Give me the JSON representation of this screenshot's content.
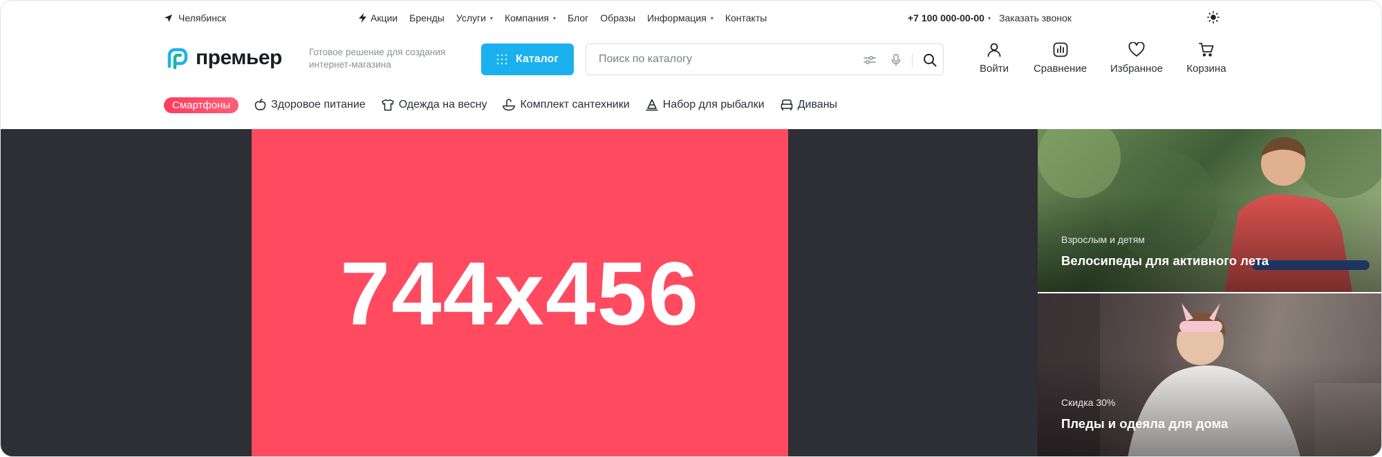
{
  "topbar": {
    "city": "Челябинск",
    "nav": [
      {
        "label": "Акции",
        "icon": "lightning-icon"
      },
      {
        "label": "Бренды"
      },
      {
        "label": "Услуги",
        "dropdown": true
      },
      {
        "label": "Компания",
        "dropdown": true
      },
      {
        "label": "Блог"
      },
      {
        "label": "Образы"
      },
      {
        "label": "Информация",
        "dropdown": true
      },
      {
        "label": "Контакты"
      }
    ],
    "phone": "+7 100 000-00-00",
    "callback": "Заказать звонок"
  },
  "header": {
    "logo_text": "премьер",
    "tagline": "Готовое решение для создания интернет-магазина",
    "catalog_label": "Каталог",
    "search_placeholder": "Поиск по каталогу",
    "actions": [
      {
        "label": "Войти",
        "icon": "user-icon"
      },
      {
        "label": "Сравнение",
        "icon": "compare-icon"
      },
      {
        "label": "Избранное",
        "icon": "heart-icon"
      },
      {
        "label": "Корзина",
        "icon": "cart-icon"
      }
    ]
  },
  "tags": [
    {
      "label": "Смартфоны",
      "highlight": true
    },
    {
      "label": "Здоровое питание",
      "icon": "apple-icon"
    },
    {
      "label": "Одежда на весну",
      "icon": "shirt-icon"
    },
    {
      "label": "Комплект сантехники",
      "icon": "faucet-icon"
    },
    {
      "label": "Набор для рыбалки",
      "icon": "fishing-icon"
    },
    {
      "label": "Диваны",
      "icon": "sofa-icon"
    }
  ],
  "hero": {
    "placeholder_text": "744x456"
  },
  "promos": [
    {
      "subtitle": "Взрослым и детям",
      "title": "Велосипеды для активного лета"
    },
    {
      "subtitle": "Скидка 30%",
      "title": "Пледы и одеяла для дома"
    }
  ],
  "colors": {
    "accent": "#1ab1ee",
    "hot": "#ff3b5c",
    "hero_bg": "#2d2f34",
    "slide": "#ff4a5f"
  }
}
